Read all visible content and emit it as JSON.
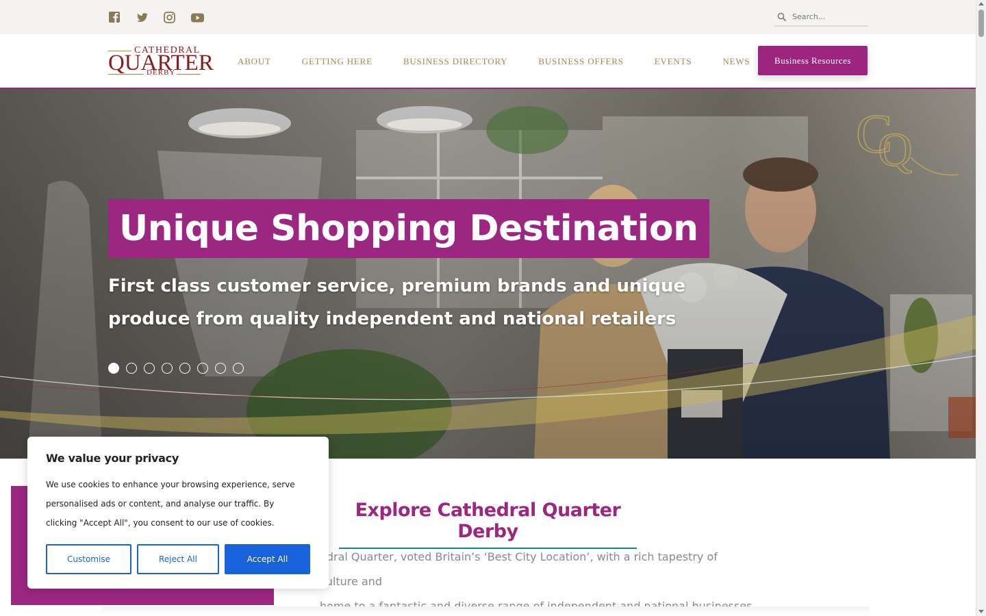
{
  "social": {
    "items": [
      {
        "name": "facebook-icon"
      },
      {
        "name": "twitter-icon"
      },
      {
        "name": "instagram-icon"
      },
      {
        "name": "youtube-icon"
      }
    ],
    "color": "#8a7a55"
  },
  "search": {
    "placeholder": "Search..."
  },
  "logo": {
    "line1": "CATHEDRAL",
    "line2": "QUARTER",
    "line3": "DERBY"
  },
  "nav": {
    "items": [
      "ABOUT",
      "GETTING HERE",
      "BUSINESS DIRECTORY",
      "BUSINESS OFFERS",
      "EVENTS",
      "NEWS"
    ],
    "resources_label": "Business Resources"
  },
  "hero": {
    "title": "Unique Shopping Destination",
    "subtitle": "First class customer service, premium brands and unique produce from quality independent and national retailers",
    "slide_count": 8,
    "active_slide": 1
  },
  "main": {
    "heading": "Explore Cathedral Quarter Derby",
    "text_line1": "edral Quarter, voted Britain’s ‘Best City Location’, with a rich tapestry of culture and",
    "text_line2": "home to a fantastic and diverse range of independent and national businesses."
  },
  "cookie": {
    "title": "We value your privacy",
    "body": "We use cookies to enhance your browsing experience, serve personalised ads or content, and analyse our traffic. By clicking \"Accept All\", you consent to our use of cookies.",
    "customise": "Customise",
    "reject": "Reject All",
    "accept": "Accept All"
  },
  "colors": {
    "brand_purple": "#9b2780",
    "gold": "#a08a52",
    "cookie_blue": "#1863dc",
    "teal": "#1a7f8a"
  }
}
